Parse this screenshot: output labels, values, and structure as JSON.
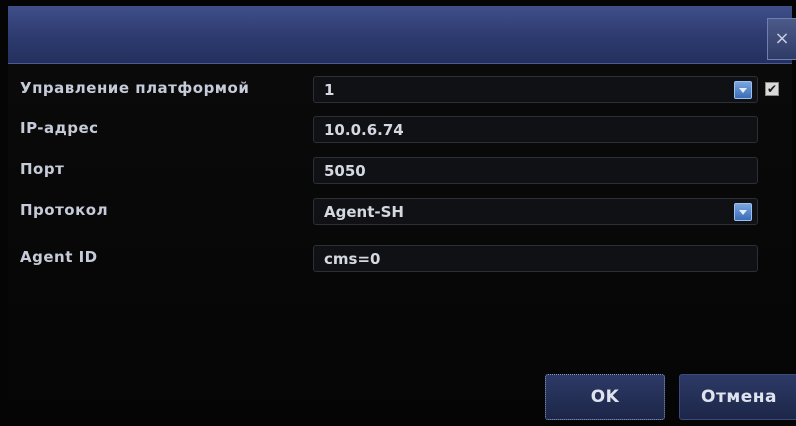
{
  "dialog": {
    "close_icon": "close-icon",
    "close_glyph": "×"
  },
  "fields": {
    "platform": {
      "label": "Управление платформой",
      "value": "1",
      "checkbox_checked": true
    },
    "ip": {
      "label": "IP-адрес",
      "value": "10.0.6.74"
    },
    "port": {
      "label": "Порт",
      "value": "5050"
    },
    "protocol": {
      "label": "Протокол",
      "value": "Agent-SH"
    },
    "agent_id": {
      "label": "Agent ID",
      "value": "cms=0"
    }
  },
  "buttons": {
    "ok_label": "OK",
    "cancel_label": "Отмена"
  },
  "colors": {
    "titlebar": "#2d3a6e",
    "background": "#050505",
    "accent": "#3a6cb8"
  }
}
